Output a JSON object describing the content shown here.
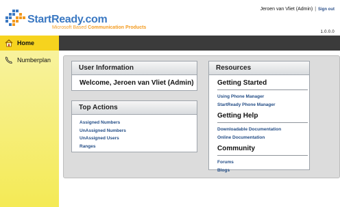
{
  "header": {
    "brand_name": "StartReady",
    "brand_tld": ".com",
    "tagline_prefix": "Microsoft Based ",
    "tagline_bold": "Communication Products",
    "user_name": "Jeroen van Vliet (Admin)",
    "separator": "|",
    "sign_out": "Sign out",
    "version": "1.0.0.0"
  },
  "colors": {
    "brand_blue": "#3a78c2",
    "brand_orange": "#f39a1e",
    "sidebar_yellow": "#f4ea55",
    "active_yellow": "#f6d31e",
    "dark_bar": "#3b3b3b",
    "link_blue": "#234d86"
  },
  "sidebar": {
    "items": [
      {
        "label": "Home",
        "icon": "home-icon",
        "active": true
      },
      {
        "label": "Numberplan",
        "icon": "phone-icon",
        "active": false
      }
    ]
  },
  "user_info": {
    "title": "User Information",
    "welcome": "Welcome, Jeroen van Vliet (Admin)"
  },
  "top_actions": {
    "title": "Top Actions",
    "links": [
      "Assigned Numbers",
      "UnAssigned Numbers",
      "UnAssigned Users",
      "Ranges"
    ]
  },
  "resources": {
    "title": "Resources",
    "sections": [
      {
        "heading": "Getting Started",
        "links": [
          "Using Phone Manager",
          "StartReady Phone Manager"
        ]
      },
      {
        "heading": "Getting Help",
        "links": [
          "Downloadable Documentation",
          "Online Documentation"
        ]
      },
      {
        "heading": "Community",
        "links": [
          "Forums",
          "Blogs"
        ]
      }
    ]
  }
}
